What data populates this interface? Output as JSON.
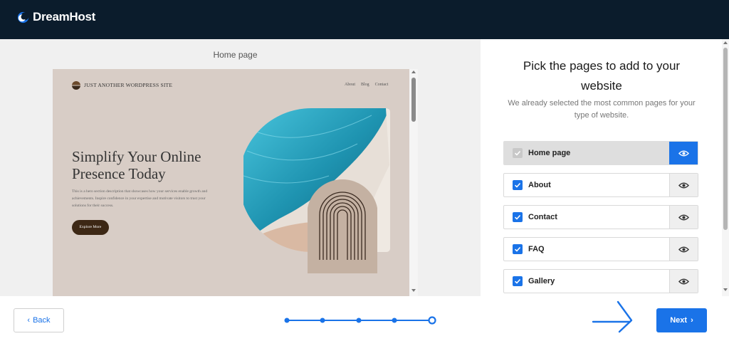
{
  "brand": {
    "name": "DreamHost"
  },
  "preview": {
    "title": "Home page",
    "site": {
      "name": "JUST ANOTHER WORDPRESS SITE",
      "nav": [
        "About",
        "Blog",
        "Contact"
      ],
      "hero_title": "Simplify Your Online Presence Today",
      "hero_description": "This is a hero section description that showcases how your services enable growth and achievements. Inspire confidence in your expertise and motivate visitors to trust your solutions for their success.",
      "hero_button": "Explore More"
    }
  },
  "panel": {
    "title": "Pick the pages to add to your website",
    "subtitle": "We already selected the most common pages for your type of website.",
    "pages": [
      {
        "label": "Home page",
        "checked": true,
        "locked": true,
        "previewing": true
      },
      {
        "label": "About",
        "checked": true,
        "locked": false,
        "previewing": false
      },
      {
        "label": "Contact",
        "checked": true,
        "locked": false,
        "previewing": false
      },
      {
        "label": "FAQ",
        "checked": true,
        "locked": false,
        "previewing": false
      },
      {
        "label": "Gallery",
        "checked": true,
        "locked": false,
        "previewing": false
      }
    ]
  },
  "footer": {
    "back_label": "Back",
    "next_label": "Next",
    "progress": {
      "total_steps": 5,
      "current_step": 5
    }
  },
  "colors": {
    "topbar": "#0b1c2c",
    "accent": "#1a73e8",
    "preview_bg": "#d8cdc6",
    "hero_button": "#3d2815"
  }
}
